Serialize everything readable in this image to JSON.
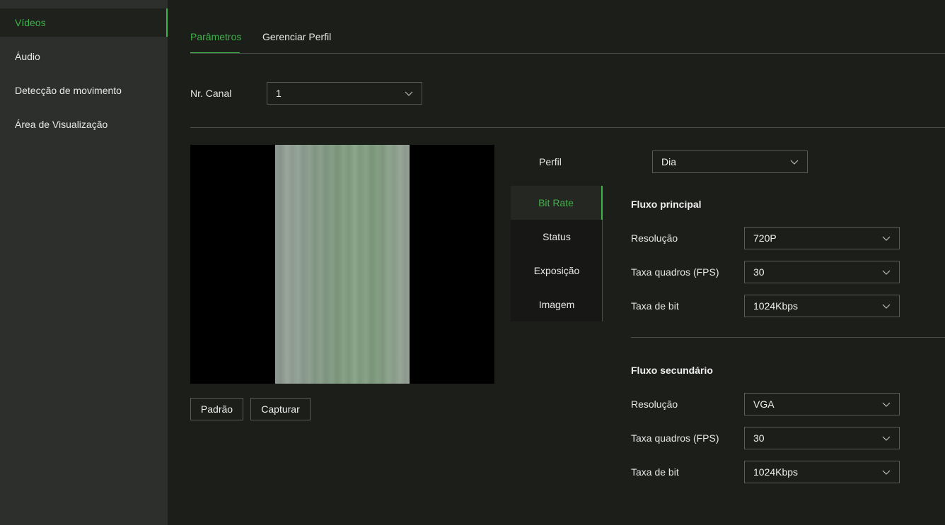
{
  "sidebar": {
    "items": [
      {
        "label": "Vídeos"
      },
      {
        "label": "Áudio"
      },
      {
        "label": "Detecção de movimento"
      },
      {
        "label": "Área de Visualização"
      }
    ]
  },
  "tabs": [
    {
      "label": "Parâmetros"
    },
    {
      "label": "Gerenciar Perfil"
    }
  ],
  "channel": {
    "label": "Nr. Canal",
    "value": "1"
  },
  "profile": {
    "label": "Perfil",
    "value": "Dia"
  },
  "subtabs": [
    {
      "label": "Bit Rate"
    },
    {
      "label": "Status"
    },
    {
      "label": "Exposição"
    },
    {
      "label": "Imagem"
    }
  ],
  "main_stream": {
    "title": "Fluxo principal",
    "resolution_label": "Resolução",
    "resolution_value": "720P",
    "fps_label": "Taxa quadros (FPS)",
    "fps_value": "30",
    "bitrate_label": "Taxa de bit",
    "bitrate_value": "1024Kbps"
  },
  "sub_stream": {
    "title": "Fluxo secundário",
    "resolution_label": "Resolução",
    "resolution_value": "VGA",
    "fps_label": "Taxa quadros (FPS)",
    "fps_value": "30",
    "bitrate_label": "Taxa de bit",
    "bitrate_value": "1024Kbps"
  },
  "buttons": {
    "default_label": "Padrão",
    "capture_label": "Capturar"
  },
  "colors": {
    "accent": "#3fb24a",
    "background": "#1c1e19",
    "sidebar": "#2d2f2c"
  }
}
